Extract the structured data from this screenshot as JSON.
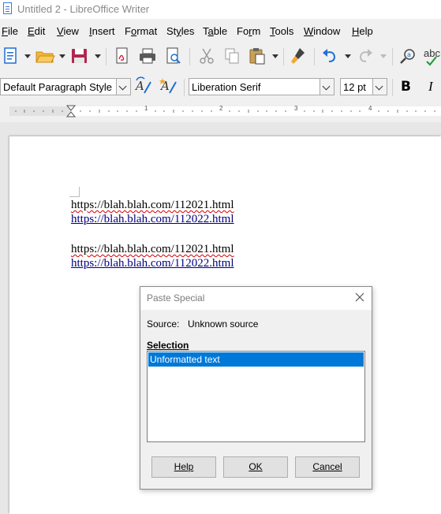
{
  "window": {
    "title": "Untitled 2 - LibreOffice Writer"
  },
  "menu": [
    {
      "label": "File",
      "key": "F"
    },
    {
      "label": "Edit",
      "key": "E"
    },
    {
      "label": "View",
      "key": "V"
    },
    {
      "label": "Insert",
      "key": "I"
    },
    {
      "label": "Format",
      "key": "o"
    },
    {
      "label": "Styles",
      "key": "y"
    },
    {
      "label": "Table",
      "key": "a"
    },
    {
      "label": "Form",
      "key": "r"
    },
    {
      "label": "Tools",
      "key": "T"
    },
    {
      "label": "Window",
      "key": "W"
    },
    {
      "label": "Help",
      "key": "H"
    }
  ],
  "format_bar": {
    "paragraph_style": "Default Paragraph Style",
    "font_name": "Liberation Serif",
    "font_size": "12 pt",
    "bold_label": "B",
    "italic_label": "I"
  },
  "toolbar": {
    "autocorrect_label": "abc"
  },
  "ruler": {
    "numbers": [
      "1",
      "2",
      "3",
      "4"
    ]
  },
  "document": {
    "lines": [
      {
        "text": "https://blah.blah.com/112021.html",
        "style": "plain-spell"
      },
      {
        "text": "https://blah.blah.com/112022.html",
        "style": "link"
      },
      {
        "text": "https://blah.blah.com/112021.html",
        "style": "plain-spell"
      },
      {
        "text": "https://blah.blah.com/112022.html",
        "style": "link"
      }
    ]
  },
  "dialog": {
    "title": "Paste Special",
    "source_label": "Source:",
    "source_value": "Unknown source",
    "selection_heading": "Selection",
    "options": [
      "Unformatted text"
    ],
    "selected_option": "Unformatted text",
    "buttons": {
      "help": "Help",
      "ok": "OK",
      "cancel": "Cancel"
    }
  },
  "colors": {
    "selection_bg": "#0078d7",
    "link": "#000080",
    "spell_underline": "#d00000"
  }
}
